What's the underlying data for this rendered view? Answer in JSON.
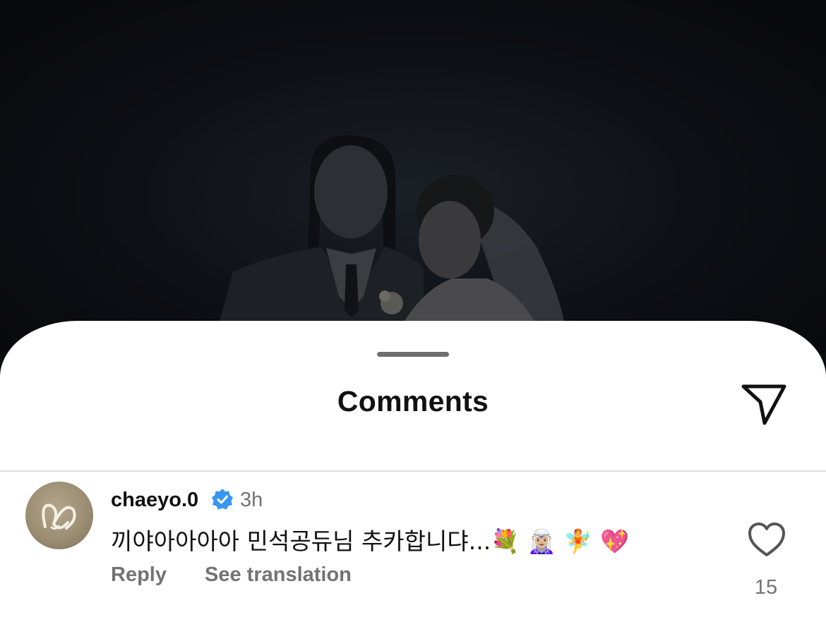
{
  "sheet": {
    "title": "Comments"
  },
  "comment": {
    "username": "chaeyo.0",
    "timestamp": "3h",
    "text": "끼야아아아아  민석공듀님 추카합니댜...",
    "emojis": [
      "💐",
      "🧝🏼‍♀️",
      "🧚",
      "💖"
    ],
    "reply_label": "Reply",
    "translate_label": "See translation",
    "like_count": "15"
  },
  "colors": {
    "verified_blue": "#3897f0",
    "muted_text": "#737373",
    "sheet_bg": "#ffffff"
  }
}
